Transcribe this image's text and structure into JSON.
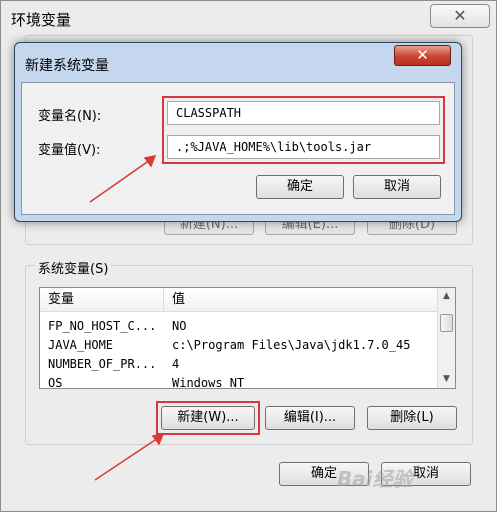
{
  "outer": {
    "title": "环境变量",
    "close_glyph": "✕",
    "user_buttons": [
      "新建(N)...",
      "编辑(E)...",
      "删除(D)"
    ],
    "system_group_label": "系统变量(S)",
    "list_headers": [
      "变量",
      "值"
    ],
    "system_vars": [
      {
        "name": "FP_NO_HOST_C...",
        "value": "NO"
      },
      {
        "name": "JAVA_HOME",
        "value": "c:\\Program Files\\Java\\jdk1.7.0_45"
      },
      {
        "name": "NUMBER_OF_PR...",
        "value": "4"
      },
      {
        "name": "OS",
        "value": "Windows_NT"
      }
    ],
    "buttons": {
      "new": "新建(W)...",
      "edit": "编辑(I)...",
      "delete": "删除(L)"
    },
    "ok": "确定",
    "cancel": "取消"
  },
  "inner": {
    "title": "新建系统变量",
    "close_glyph": "✕",
    "name_label": "变量名(N):",
    "value_label": "变量值(V):",
    "name_value": "CLASSPATH",
    "value_value": ".;%JAVA_HOME%\\lib\\tools.jar",
    "ok": "确定",
    "cancel": "取消"
  },
  "watermark": "Bai经验",
  "colors": {
    "highlight_red": "#d63a3a",
    "arrow_red": "#d63a3a",
    "title_close_red": "#c74631"
  },
  "icons": {
    "scroll_up": "scroll-up-arrow-icon",
    "scroll_down": "scroll-down-arrow-icon"
  }
}
